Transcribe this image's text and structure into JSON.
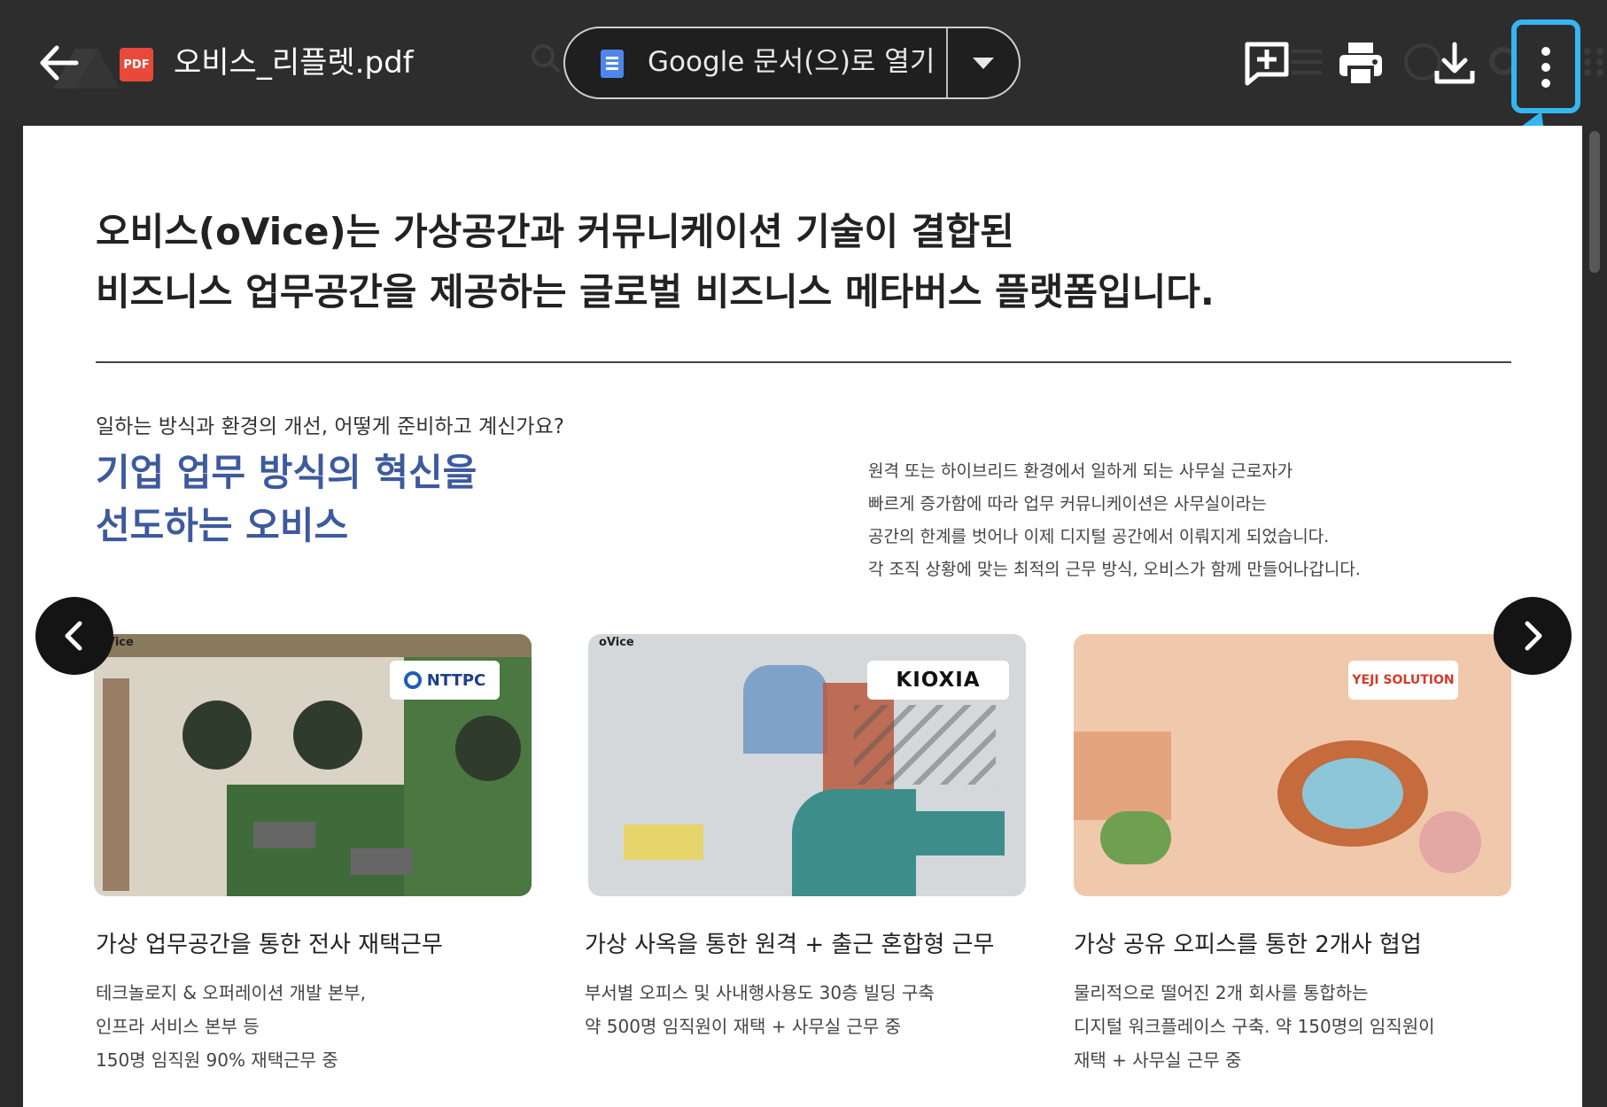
{
  "topbar": {
    "file_name": "오비스_리플렛.pdf",
    "pdf_badge": "PDF",
    "open_with_label": "Google 문서(으)로 열기",
    "icons": [
      "arrow-left-icon",
      "pdf-file-icon",
      "docs-icon",
      "caret-down-icon",
      "add-comment-icon",
      "print-icon",
      "download-icon",
      "more-vert-icon"
    ],
    "highlight_color": "#35b6f1"
  },
  "document": {
    "headline_line1": "오비스(oVice)는 가상공간과 커뮤니케이션 기술이 결합된",
    "headline_line2": "비즈니스 업무공간을 제공하는 글로벌 비즈니스 메타버스 플랫폼입니다.",
    "question": "일하는 방식과 환경의 개선, 어떻게 준비하고 계신가요?",
    "blue_title_line1": "기업 업무 방식의 혁신을",
    "blue_title_line2": "선도하는 오비스",
    "accent_color": "#3d5a9e",
    "description": [
      "원격 또는 하이브리드 환경에서 일하게 되는 사무실 근로자가",
      "빠르게 증가함에 따라 업무 커뮤니케이션은 사무실이라는",
      "공간의 한계를 벗어나 이제 디지털 공간에서 이뤄지게 되었습니다.",
      "각 조직 상황에 맞는 최적의 근무 방식, 오비스가 함께 만들어나갑니다."
    ],
    "cards": [
      {
        "logo": "NTTPC",
        "watermark": "Vice",
        "title": "가상 업무공간을 통한 전사 재택근무",
        "lines": [
          "테크놀로지 & 오퍼레이션 개발 본부,",
          "인프라 서비스 본부 등",
          "150명 임직원 90% 재택근무 중"
        ]
      },
      {
        "logo": "KIOXIA",
        "watermark": "oVice",
        "title": "가상 사옥을 통한 원격 + 출근 혼합형 근무",
        "lines": [
          "부서별 오피스 및 사내행사용도 30층 빌딩 구축",
          "약 500명 임직원이 재택 + 사무실 근무 중"
        ]
      },
      {
        "logo": "YEJI SOLUTION",
        "watermark": "",
        "title": "가상 공유 오피스를 통한 2개사 협업",
        "lines": [
          "물리적으로 떨어진 2개 회사를 통합하는",
          "디지털 워크플레이스 구축. 약 150명의 임직원이",
          "재택 + 사무실 근무 중"
        ]
      }
    ]
  }
}
